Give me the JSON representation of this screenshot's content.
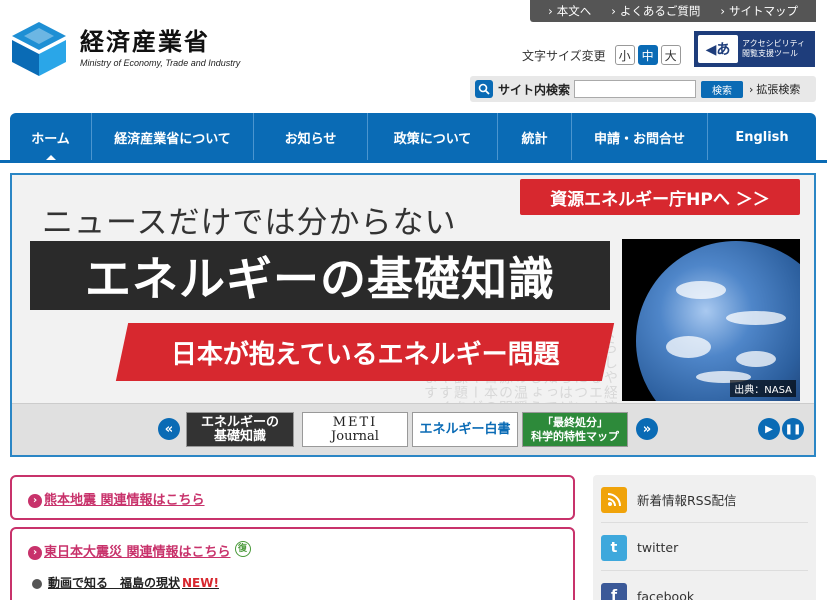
{
  "header": {
    "logo_ja": "経済産業省",
    "logo_en": "Ministry of Economy, Trade and Industry",
    "util_links": [
      "本文へ",
      "よくあるご質問",
      "サイトマップ"
    ],
    "fontsize_label": "文字サイズ変更",
    "fontsize_options": [
      "小",
      "中",
      "大"
    ],
    "fontsize_selected": "中",
    "access_tool_line1": "アクセシビリティ",
    "access_tool_line2": "閲覧支援ツール",
    "search_label": "サイト内検索",
    "search_value": "",
    "search_button": "検索",
    "advanced_search": "拡張検索"
  },
  "nav": {
    "items": [
      "ホーム",
      "経済産業省について",
      "お知らせ",
      "政策について",
      "統計",
      "申請・お問合せ",
      "English"
    ],
    "active": "ホーム"
  },
  "banner": {
    "kicker": "ニュースだけでは分からない",
    "title": "エネルギーの基礎知識",
    "subtitle": "日本が抱えているエネルギー問題",
    "cta": "資源エネルギー庁HPへ ＞＞",
    "photo_credit": "出典：NASA",
    "bg_text": "くらしや経済を支えるエネルギーについて私たちはどれだけ知っているでしょうか世界の温暖化や資源の問題など日本のエネルギーが抱える課題をわかりやすく解説します",
    "thumbs": [
      {
        "line1": "エネルギーの",
        "line2": "基礎知識"
      },
      {
        "line1": "METI",
        "line2": "Journal"
      },
      {
        "line1": "エネルギー白書",
        "line2": ""
      },
      {
        "line1": "「最終処分」",
        "line2": "科学的特性マップ"
      }
    ],
    "prev_label": "«",
    "next_label": "»"
  },
  "notices": {
    "kumamoto": "熊本地震 関連情報はこちら",
    "higashi": "東日本大震災 関連情報はこちら",
    "fuku_badge": "復",
    "fukushima_link": "動画で知る　福島の現状",
    "new_badge": "NEW!"
  },
  "side": {
    "items": [
      {
        "label": "新着情報RSS配信",
        "icon": "rss-icon",
        "color": "#f0a30a",
        "glyph": "◉"
      },
      {
        "label": "twitter",
        "icon": "twitter-icon",
        "color": "#3ea8dc",
        "glyph": "t"
      },
      {
        "label": "facebook",
        "icon": "facebook-icon",
        "color": "#3b5998",
        "glyph": "f"
      }
    ]
  },
  "colors": {
    "brand_blue": "#0a6bb5",
    "accent_red": "#d7282f",
    "notice_pink": "#c8326b"
  }
}
